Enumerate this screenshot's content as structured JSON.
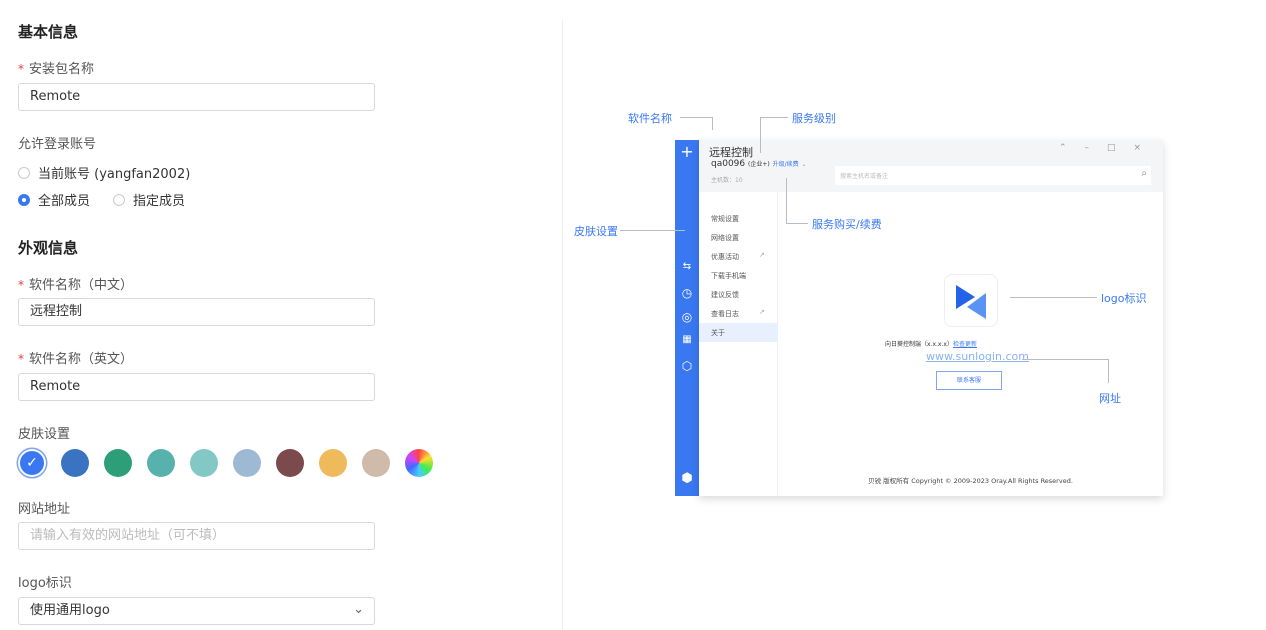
{
  "basic": {
    "heading": "基本信息",
    "package_label": "安装包名称",
    "package_value": "Remote",
    "account_label": "允许登录账号",
    "radio_current": "当前账号 (yangfan2002)",
    "radio_all": "全部成员",
    "radio_specific": "指定成员",
    "selected": "全部成员"
  },
  "appearance": {
    "heading": "外观信息",
    "name_cn_label": "软件名称（中文）",
    "name_cn_value": "远程控制",
    "name_en_label": "软件名称（英文）",
    "name_en_value": "Remote",
    "skin_label": "皮肤设置",
    "skins": [
      "#3a78f2",
      "#3a73c2",
      "#2e9e78",
      "#57b1ac",
      "#84c8c6",
      "#9db9d3",
      "#7a4a4c",
      "#eeba5c",
      "#d0baa9",
      "rainbow"
    ],
    "selected_skin": 0,
    "website_label": "网站地址",
    "website_placeholder": "请输入有效的网站地址（可不填）",
    "logo_label": "logo标识",
    "logo_value": "使用通用logo"
  },
  "preview": {
    "title": "远程控制",
    "account": "qa0096",
    "level": "(企业+)",
    "upgrade": "升级/续费",
    "hosts": "主机数：10",
    "search_placeholder": "搜索主机名或备注",
    "menu": [
      "常规设置",
      "网络设置",
      "优惠活动",
      "下载手机端",
      "建议反馈",
      "查看日志",
      "关于"
    ],
    "selected_menu": "关于",
    "version": "向日葵控制端（x.x.x.x）",
    "check_update": "检查更新",
    "website": "www.sunlogin.com",
    "contact": "联系客服",
    "copyright": "贝锐 版权所有 Copyright © 2009-2023  Oray.All Rights Reserved.",
    "accent": "#3a78f2"
  },
  "annotations": {
    "software_name": "软件名称",
    "service_level": "服务级别",
    "skin": "皮肤设置",
    "purchase": "服务购买/续费",
    "logo": "logo标识",
    "website": "网址"
  }
}
